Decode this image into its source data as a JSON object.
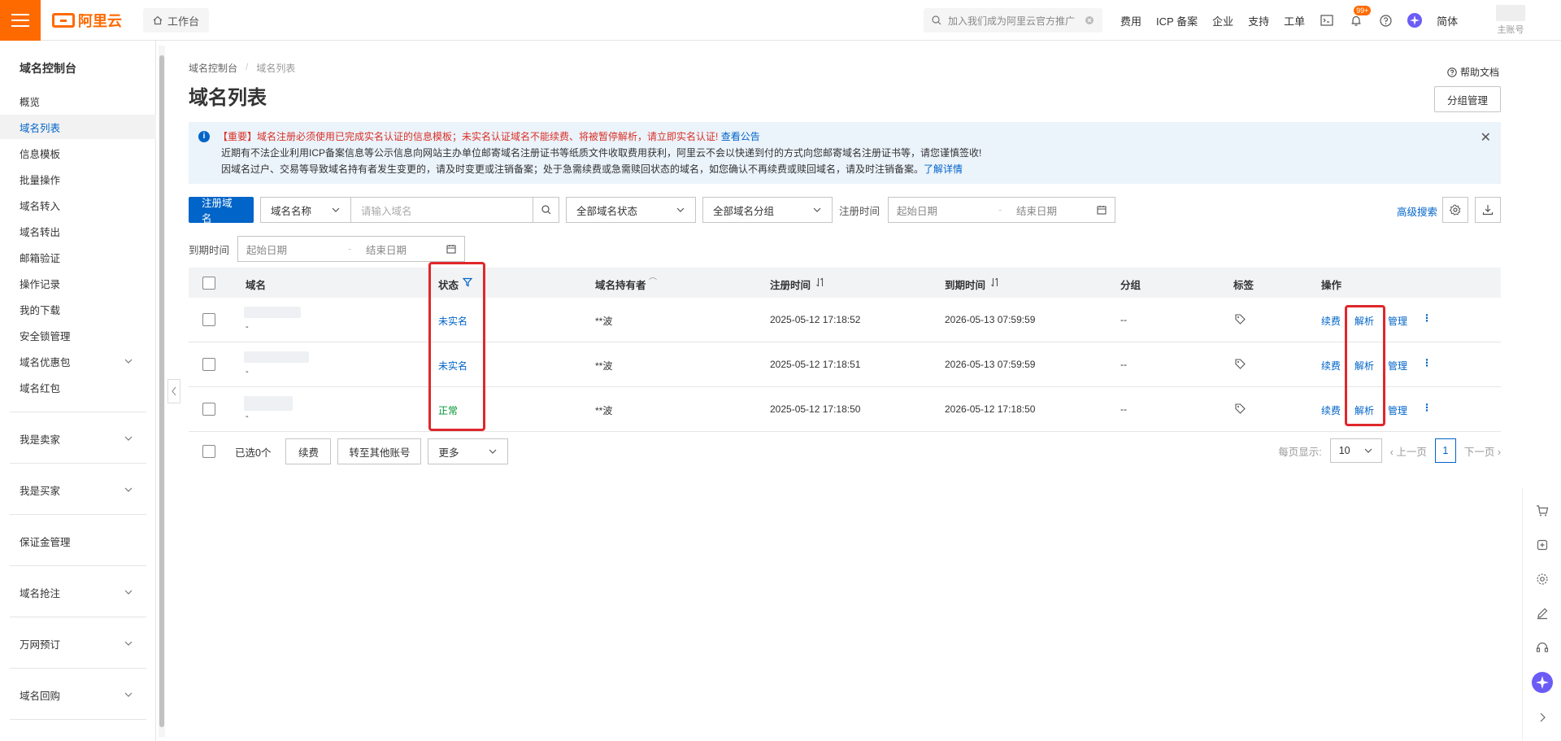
{
  "topbar": {
    "brand": "阿里云",
    "workbench": "工作台",
    "search_placeholder": "加入我们成为阿里云官方推广",
    "nav": [
      "费用",
      "ICP 备案",
      "企业",
      "支持",
      "工单"
    ],
    "badge": "99+",
    "lang": "简体",
    "account": "主账号"
  },
  "sidebar": {
    "title": "域名控制台",
    "items": [
      "概览",
      "域名列表",
      "信息模板",
      "批量操作",
      "域名转入",
      "域名转出",
      "邮箱验证",
      "操作记录",
      "我的下载",
      "安全锁管理",
      "域名优惠包",
      "域名红包"
    ],
    "groups": [
      "我是卖家",
      "我是买家",
      "保证金管理",
      "域名抢注",
      "万网预订",
      "域名回购"
    ]
  },
  "breadcrumb": {
    "parent": "域名控制台",
    "current": "域名列表"
  },
  "page": {
    "title": "域名列表",
    "help": "帮助文档",
    "group_btn": "分组管理"
  },
  "notice": {
    "line1_red": "【重要】域名注册必须使用已完成实名认证的信息模板；未实名认证域名不能续费、将被暂停解析，请立即实名认证!",
    "line1_link": "查看公告",
    "line2": "近期有不法企业利用ICP备案信息等公示信息向网站主办单位邮寄域名注册证书等纸质文件收取费用获利，阿里云不会以快递到付的方式向您邮寄域名注册证书等，请您谨慎签收!",
    "line3": "因域名过户、交易等导致域名持有者发生变更的，请及时变更或注销备案；处于急需续费或急需赎回状态的域名，如您确认不再续费或赎回域名，请及时注销备案。",
    "line3_link": "了解详情"
  },
  "filters": {
    "register_btn": "注册域名",
    "name_select": "域名名称",
    "name_placeholder": "请输入域名",
    "status_select": "全部域名状态",
    "group_select": "全部域名分组",
    "reg_time_label": "注册时间",
    "start_date": "起始日期",
    "end_date": "结束日期",
    "dash": "-",
    "advanced": "高级搜索",
    "expire_label": "到期时间"
  },
  "table": {
    "headers": [
      "域名",
      "状态",
      "域名持有者",
      "注册时间",
      "到期时间",
      "分组",
      "标签",
      "操作"
    ],
    "rows": [
      {
        "sub": "-",
        "status": "未实名",
        "holder": "**波",
        "reg": "2025-05-12 17:18:52",
        "exp": "2026-05-13 07:59:59",
        "group": "--"
      },
      {
        "sub": "-",
        "status": "未实名",
        "holder": "**波",
        "reg": "2025-05-12 17:18:51",
        "exp": "2026-05-13 07:59:59",
        "group": "--"
      },
      {
        "sub": "-",
        "status": "正常",
        "holder": "**波",
        "reg": "2025-05-12 17:18:50",
        "exp": "2026-05-12 17:18:50",
        "group": "--"
      }
    ],
    "actions": {
      "renew": "续费",
      "resolve": "解析",
      "manage": "管理"
    }
  },
  "footer": {
    "selected": "已选0个",
    "renew": "续费",
    "transfer": "转至其他账号",
    "more": "更多",
    "per_page_label": "每页显示:",
    "per_page": "10",
    "prev": "上一页",
    "page": "1",
    "next": "下一页"
  },
  "colors": {
    "brand": "#ff6a00",
    "link": "#0064c8",
    "highlight": "#e0272b",
    "ok": "#009431"
  }
}
